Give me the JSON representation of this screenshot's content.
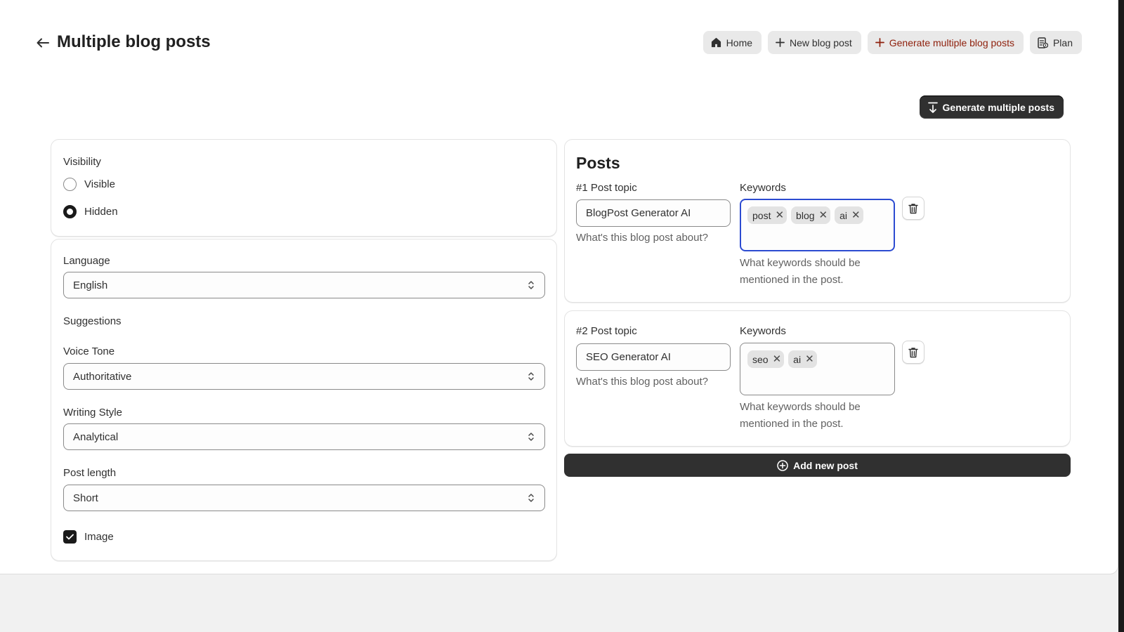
{
  "header": {
    "title": "Multiple blog posts",
    "actions": [
      {
        "label": "Home",
        "icon": "home-icon"
      },
      {
        "label": "New blog post",
        "icon": "plus-icon"
      },
      {
        "label": "Generate multiple blog posts",
        "icon": "plus-icon",
        "accent": "#8e1f0b"
      },
      {
        "label": "Plan",
        "icon": "plan-icon"
      }
    ]
  },
  "primary_action": {
    "label": "Generate multiple posts",
    "icon": "import-icon"
  },
  "visibility": {
    "label": "Visibility",
    "options": [
      {
        "label": "Visible",
        "selected": false
      },
      {
        "label": "Hidden",
        "selected": true
      }
    ]
  },
  "settings": {
    "language": {
      "label": "Language",
      "value": "English"
    },
    "suggestions_label": "Suggestions",
    "voice_tone": {
      "label": "Voice Tone",
      "value": "Authoritative"
    },
    "writing_style": {
      "label": "Writing Style",
      "value": "Analytical"
    },
    "post_length": {
      "label": "Post length",
      "value": "Short"
    },
    "image": {
      "label": "Image",
      "checked": true
    }
  },
  "posts": {
    "title": "Posts",
    "items": [
      {
        "topic_label": "#1 Post topic",
        "topic_value": "BlogPost Generator AI",
        "topic_help": "What's this blog post about?",
        "keywords_label": "Keywords",
        "keywords": [
          "post",
          "blog",
          "ai"
        ],
        "keywords_help_1": "What keywords should be",
        "keywords_help_2": "mentioned in the post."
      },
      {
        "topic_label": "#2 Post topic",
        "topic_value": "SEO Generator AI",
        "topic_help": "What's this blog post about?",
        "keywords_label": "Keywords",
        "keywords": [
          "seo",
          "ai"
        ],
        "keywords_help_1": "What keywords should be",
        "keywords_help_2": "mentioned in the post."
      }
    ],
    "add_label": "Add new post"
  },
  "colors": {
    "dark_button": "#303030",
    "focus_ring": "#2c4bd1",
    "accent_text": "#8e1f0b"
  }
}
